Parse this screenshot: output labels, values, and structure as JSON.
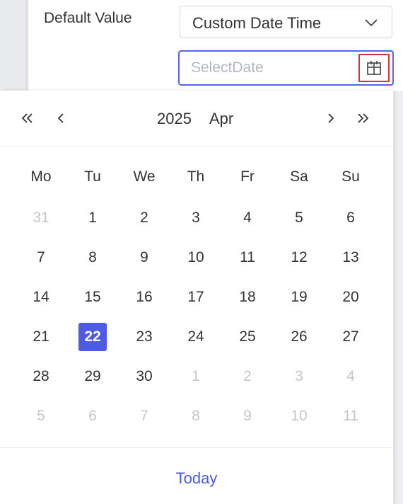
{
  "form": {
    "default_value_label": "Default Value",
    "select_value": "Custom Date Time",
    "date_placeholder": "SelectDate",
    "date_value": ""
  },
  "calendar": {
    "year": "2025",
    "month": "Apr",
    "weekdays": [
      "Mo",
      "Tu",
      "We",
      "Th",
      "Fr",
      "Sa",
      "Su"
    ],
    "weeks": [
      [
        {
          "d": "31",
          "muted": true
        },
        {
          "d": "1"
        },
        {
          "d": "2"
        },
        {
          "d": "3"
        },
        {
          "d": "4"
        },
        {
          "d": "5"
        },
        {
          "d": "6"
        }
      ],
      [
        {
          "d": "7"
        },
        {
          "d": "8"
        },
        {
          "d": "9"
        },
        {
          "d": "10"
        },
        {
          "d": "11"
        },
        {
          "d": "12"
        },
        {
          "d": "13"
        }
      ],
      [
        {
          "d": "14"
        },
        {
          "d": "15"
        },
        {
          "d": "16"
        },
        {
          "d": "17"
        },
        {
          "d": "18"
        },
        {
          "d": "19"
        },
        {
          "d": "20"
        }
      ],
      [
        {
          "d": "21"
        },
        {
          "d": "22",
          "selected": true
        },
        {
          "d": "23"
        },
        {
          "d": "24"
        },
        {
          "d": "25"
        },
        {
          "d": "26"
        },
        {
          "d": "27"
        }
      ],
      [
        {
          "d": "28"
        },
        {
          "d": "29"
        },
        {
          "d": "30"
        },
        {
          "d": "1",
          "muted": true
        },
        {
          "d": "2",
          "muted": true
        },
        {
          "d": "3",
          "muted": true
        },
        {
          "d": "4",
          "muted": true
        }
      ],
      [
        {
          "d": "5",
          "muted": true
        },
        {
          "d": "6",
          "muted": true
        },
        {
          "d": "7",
          "muted": true
        },
        {
          "d": "8",
          "muted": true
        },
        {
          "d": "9",
          "muted": true
        },
        {
          "d": "10",
          "muted": true
        },
        {
          "d": "11",
          "muted": true
        }
      ]
    ],
    "today_label": "Today"
  },
  "icons": {
    "prev_year": "double-chevron-left-icon",
    "prev_month": "chevron-left-icon",
    "next_month": "chevron-right-icon",
    "next_year": "double-chevron-right-icon",
    "select_arrow": "chevron-down-icon",
    "calendar": "calendar-icon"
  },
  "colors": {
    "accent": "#4d5ae6",
    "input_focus_border": "#5a63e8",
    "highlight_border": "#e02d3c",
    "muted_text": "#c3c6cc"
  }
}
